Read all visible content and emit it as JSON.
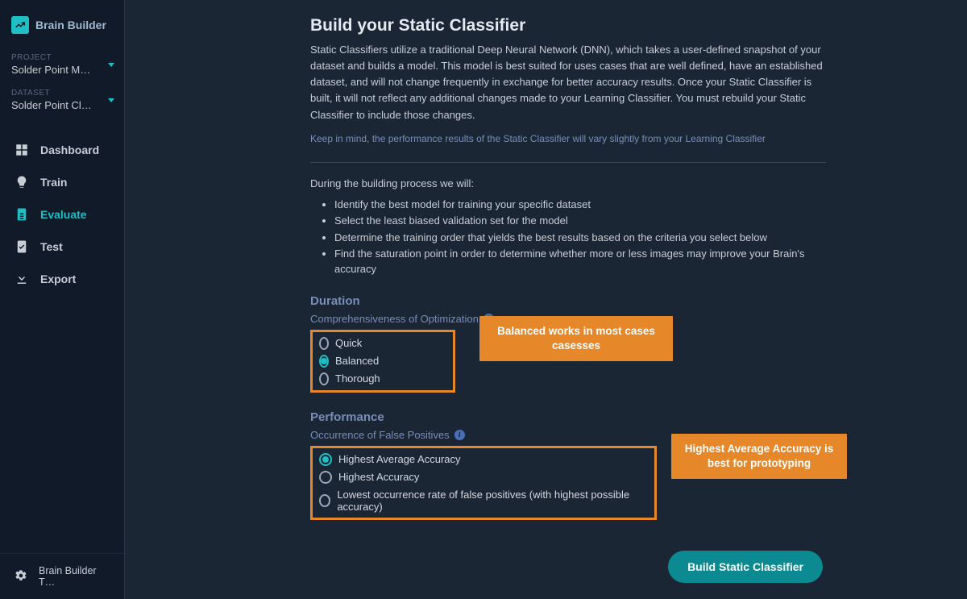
{
  "app": {
    "name": "Brain Builder",
    "settings_label": "Brain Builder T…"
  },
  "selectors": {
    "project": {
      "label": "PROJECT",
      "value": "Solder Point M…"
    },
    "dataset": {
      "label": "DATASET",
      "value": "Solder Point Cl…"
    }
  },
  "nav": {
    "dashboard": "Dashboard",
    "train": "Train",
    "evaluate": "Evaluate",
    "test": "Test",
    "export": "Export",
    "active": "evaluate"
  },
  "page": {
    "title": "Build your Static Classifier",
    "description": "Static Classifiers utilize a traditional Deep Neural Network (DNN), which takes a user-defined snapshot of your dataset and builds a model. This model is best suited for uses cases that are well defined, have an established dataset, and will not change frequently in exchange for better accuracy results. Once your Static Classifier is built, it will not reflect any additional changes made to your Learning Classifier. You must rebuild your Static Classifier to include those changes.",
    "note": "Keep in mind, the performance results of the Static Classifier will vary slightly from your Learning Classifier",
    "process_intro": "During the building process we will:",
    "bullets": [
      "Identify the best model for training your specific dataset",
      "Select the least biased validation set for the model",
      "Determine the training order that yields the best results based on the criteria you select below",
      "Find the saturation point in order to determine whether more or less images may improve your Brain's accuracy"
    ]
  },
  "duration": {
    "heading": "Duration",
    "sub": "Comprehensiveness of Optimization",
    "options": {
      "quick": "Quick",
      "balanced": "Balanced",
      "thorough": "Thorough"
    },
    "selected": "balanced",
    "callout": "Balanced works in most cases casesses"
  },
  "performance": {
    "heading": "Performance",
    "sub": "Occurrence of False Positives",
    "options": {
      "highest_avg": "Highest Average Accuracy",
      "highest": "Highest Accuracy",
      "lowest_fp": "Lowest occurrence rate of false positives (with highest possible accuracy)"
    },
    "selected": "highest_avg",
    "callout": "Highest Average Accuracy is best for prototyping"
  },
  "actions": {
    "build": "Build Static Classifier"
  }
}
